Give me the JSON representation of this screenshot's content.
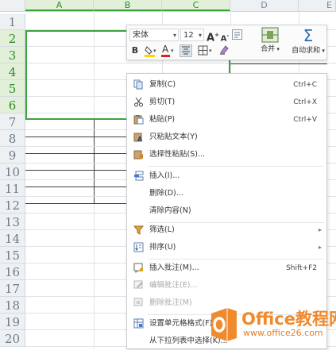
{
  "sheet": {
    "columns": [
      {
        "label": "A",
        "selected": true
      },
      {
        "label": "B",
        "selected": true
      },
      {
        "label": "C",
        "selected": true
      },
      {
        "label": "D",
        "selected": false
      },
      {
        "label": "E",
        "selected": false
      }
    ],
    "rows": [
      "1",
      "2",
      "3",
      "4",
      "5",
      "6",
      "7",
      "8",
      "9",
      "10",
      "11",
      "12",
      "13",
      "14",
      "15",
      "16",
      "17",
      "18",
      "19",
      "20"
    ],
    "selected_rows": [
      "2",
      "3",
      "4",
      "5",
      "6"
    ],
    "selection_color": "#3fa13f"
  },
  "mini_toolbar": {
    "font_name": "宋体",
    "font_size": "12",
    "grow_font": "A",
    "shrink_font": "A",
    "bold": "B",
    "font_color_letter": "A",
    "merge_label": "合并",
    "autosum_label": "自动求和",
    "autosum_symbol": "Σ",
    "icons": [
      "grow-font-icon",
      "shrink-font-icon",
      "format-icon",
      "bold-icon",
      "fill-color-icon",
      "font-color-icon",
      "align-center-icon",
      "border-icon",
      "clear-format-icon",
      "merge-icon",
      "autosum-icon"
    ]
  },
  "context_menu": {
    "items": [
      {
        "label": "复制(C)",
        "shortcut": "Ctrl+C",
        "icon": "copy-icon"
      },
      {
        "label": "剪切(T)",
        "shortcut": "Ctrl+X",
        "icon": "cut-icon"
      },
      {
        "label": "粘贴(P)",
        "shortcut": "Ctrl+V",
        "icon": "paste-icon"
      },
      {
        "label": "只粘贴文本(Y)",
        "shortcut": "",
        "icon": "paste-text-icon"
      },
      {
        "label": "选择性粘贴(S)...",
        "shortcut": "",
        "icon": "paste-special-icon"
      },
      {
        "label": "插入(I)...",
        "shortcut": "",
        "icon": "insert-icon"
      },
      {
        "label": "删除(D)...",
        "shortcut": "",
        "icon": ""
      },
      {
        "label": "清除内容(N)",
        "shortcut": "",
        "icon": ""
      },
      {
        "label": "筛选(L)",
        "shortcut": "",
        "icon": "filter-icon"
      },
      {
        "label": "排序(U)",
        "shortcut": "",
        "icon": "sort-icon"
      },
      {
        "label": "插入批注(M)...",
        "shortcut": "Shift+F2",
        "icon": "insert-comment-icon"
      },
      {
        "label": "编辑批注(E)...",
        "shortcut": "",
        "icon": "edit-comment-icon"
      },
      {
        "label": "删除批注(M)",
        "shortcut": "",
        "icon": "delete-comment-icon"
      },
      {
        "label": "设置单元格格式(F)...",
        "shortcut": "",
        "icon": "format-cells-icon"
      },
      {
        "label": "从下拉列表中选择(K)...",
        "shortcut": "",
        "icon": ""
      }
    ],
    "submenu_arrow": "▸"
  },
  "watermark": {
    "brand": "Office教程网",
    "url": "www.office26.com",
    "color": "#f08a2c"
  }
}
